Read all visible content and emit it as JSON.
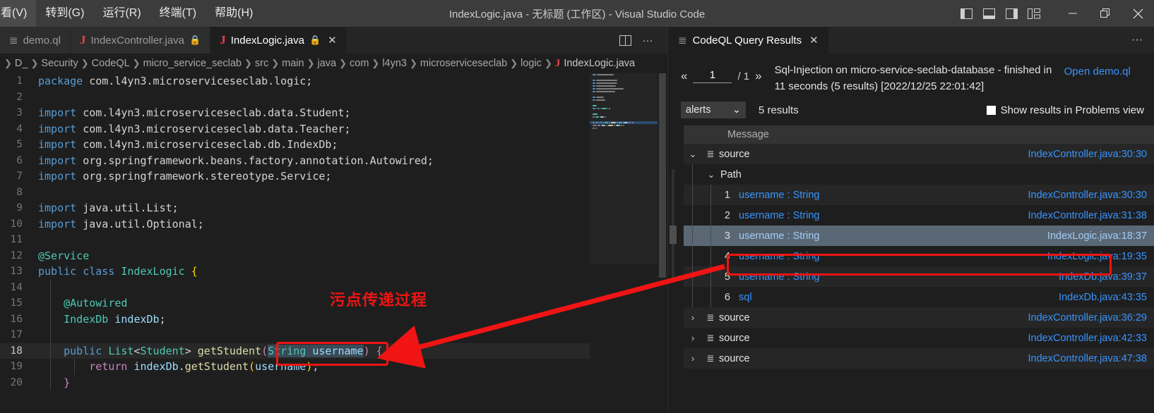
{
  "window": {
    "title": "IndexLogic.java - 无标题 (工作区) - Visual Studio Code",
    "menu": [
      "看(V)",
      "转到(G)",
      "运行(R)",
      "终端(T)",
      "帮助(H)"
    ],
    "layout_buttons": [
      {
        "name": "toggle-primary-sidebar",
        "label": "▉"
      },
      {
        "name": "toggle-panel",
        "label": "▤"
      },
      {
        "name": "toggle-secondary-sidebar",
        "label": "▥"
      },
      {
        "name": "customize-layout",
        "label": "▦"
      }
    ],
    "controls": {
      "minimize": "—",
      "restore": "❐",
      "close": "✕"
    }
  },
  "editor": {
    "tabs": [
      {
        "icon": "ql-icon",
        "label": "demo.ql",
        "active": false,
        "locked": false,
        "closable": false
      },
      {
        "icon": "java-icon",
        "label": "IndexController.java",
        "active": false,
        "locked": true,
        "closable": false
      },
      {
        "icon": "java-icon",
        "label": "IndexLogic.java",
        "active": true,
        "locked": true,
        "closable": true
      }
    ],
    "tab_actions": [
      {
        "name": "split-editor-icon",
        "label": "⫿⫿"
      },
      {
        "name": "more-actions-icon",
        "label": "···"
      }
    ],
    "breadcrumb": [
      "D_",
      "Security",
      "CodeQL",
      "micro_service_seclab",
      "src",
      "main",
      "java",
      "com",
      "l4yn3",
      "microserviceseclab",
      "logic",
      "IndexLogic.java"
    ],
    "current_line": 18,
    "lines": [
      {
        "n": 1,
        "tokens": [
          {
            "t": "package",
            "c": "kw"
          },
          {
            "t": " com.l4yn3.microserviceseclab.logic;",
            "c": "punc"
          }
        ]
      },
      {
        "n": 2,
        "tokens": []
      },
      {
        "n": 3,
        "tokens": [
          {
            "t": "import",
            "c": "kw"
          },
          {
            "t": " com.l4yn3.microserviceseclab.data.Student;",
            "c": "punc"
          }
        ]
      },
      {
        "n": 4,
        "tokens": [
          {
            "t": "import",
            "c": "kw"
          },
          {
            "t": " com.l4yn3.microserviceseclab.data.Teacher;",
            "c": "punc"
          }
        ]
      },
      {
        "n": 5,
        "tokens": [
          {
            "t": "import",
            "c": "kw"
          },
          {
            "t": " com.l4yn3.microserviceseclab.db.IndexDb;",
            "c": "punc"
          }
        ]
      },
      {
        "n": 6,
        "tokens": [
          {
            "t": "import",
            "c": "kw"
          },
          {
            "t": " org.springframework.beans.factory.annotation.Autowired;",
            "c": "punc"
          }
        ]
      },
      {
        "n": 7,
        "tokens": [
          {
            "t": "import",
            "c": "kw"
          },
          {
            "t": " org.springframework.stereotype.Service;",
            "c": "punc"
          }
        ]
      },
      {
        "n": 8,
        "tokens": []
      },
      {
        "n": 9,
        "tokens": [
          {
            "t": "import",
            "c": "kw"
          },
          {
            "t": " java.util.List;",
            "c": "punc"
          }
        ]
      },
      {
        "n": 10,
        "tokens": [
          {
            "t": "import",
            "c": "kw"
          },
          {
            "t": " java.util.Optional;",
            "c": "punc"
          }
        ]
      },
      {
        "n": 11,
        "tokens": []
      },
      {
        "n": 12,
        "tokens": [
          {
            "t": "@Service",
            "c": "ann"
          }
        ]
      },
      {
        "n": 13,
        "tokens": [
          {
            "t": "public",
            "c": "kw"
          },
          {
            "t": " ",
            "c": "punc"
          },
          {
            "t": "class",
            "c": "kw"
          },
          {
            "t": " ",
            "c": "punc"
          },
          {
            "t": "IndexLogic",
            "c": "typ"
          },
          {
            "t": " ",
            "c": "punc"
          },
          {
            "t": "{",
            "c": "br1"
          }
        ]
      },
      {
        "n": 14,
        "tokens": []
      },
      {
        "n": 15,
        "tokens": [
          {
            "t": "    @Autowired",
            "c": "ann"
          }
        ]
      },
      {
        "n": 16,
        "tokens": [
          {
            "t": "    ",
            "c": "punc"
          },
          {
            "t": "IndexDb",
            "c": "typ"
          },
          {
            "t": " ",
            "c": "punc"
          },
          {
            "t": "indexDb",
            "c": "var"
          },
          {
            "t": ";",
            "c": "punc"
          }
        ]
      },
      {
        "n": 17,
        "tokens": []
      },
      {
        "n": 18,
        "tokens": [
          {
            "t": "    ",
            "c": "punc"
          },
          {
            "t": "public",
            "c": "kw"
          },
          {
            "t": " ",
            "c": "punc"
          },
          {
            "t": "List",
            "c": "typ"
          },
          {
            "t": "<",
            "c": "punc"
          },
          {
            "t": "Student",
            "c": "typ"
          },
          {
            "t": "> ",
            "c": "punc"
          },
          {
            "t": "getStudent",
            "c": "fn"
          },
          {
            "t": "(",
            "c": "kw2"
          },
          {
            "t": "String",
            "c": "typ sel"
          },
          {
            "t": " ",
            "c": "sel"
          },
          {
            "t": "username",
            "c": "var sel"
          },
          {
            "t": ")",
            "c": "kw2"
          },
          {
            "t": " ",
            "c": "punc"
          },
          {
            "t": "{",
            "c": "kw2"
          }
        ]
      },
      {
        "n": 19,
        "tokens": [
          {
            "t": "        ",
            "c": "punc"
          },
          {
            "t": "return",
            "c": "kw2"
          },
          {
            "t": " ",
            "c": "punc"
          },
          {
            "t": "indexDb",
            "c": "var"
          },
          {
            "t": ".",
            "c": "punc"
          },
          {
            "t": "getStudent",
            "c": "fn"
          },
          {
            "t": "(",
            "c": "br1"
          },
          {
            "t": "username",
            "c": "var"
          },
          {
            "t": ")",
            "c": "br1"
          },
          {
            "t": ";",
            "c": "punc"
          }
        ]
      },
      {
        "n": 20,
        "tokens": [
          {
            "t": "    ",
            "c": "punc"
          },
          {
            "t": "}",
            "c": "kw2"
          }
        ]
      }
    ]
  },
  "results_panel": {
    "tab": {
      "label": "CodeQL Query Results",
      "icon": "list-icon",
      "close": "✕"
    },
    "more_actions": "···",
    "pager": {
      "prev": "«",
      "next": "»",
      "current_page": "1",
      "total": "/ 1"
    },
    "query_description": "Sql-Injection on micro-service-seclab-database - finished in 11 seconds (5 results) [2022/12/25 22:01:42]",
    "open_link": "Open demo.ql",
    "filter_select": {
      "value": "alerts",
      "chevron": "⌄"
    },
    "results_count": "5 results",
    "problems_checkbox": {
      "label": "Show results in Problems view",
      "checked": false
    },
    "column_header": "Message",
    "rows": [
      {
        "level": 0,
        "twisty": "⌄",
        "icon": "list-icon",
        "message": "source",
        "location": "IndexController.java:30:30",
        "style": "alt",
        "selected": false,
        "index": null
      },
      {
        "level": 1,
        "twisty": "⌄",
        "icon": "",
        "message": "Path",
        "location": "",
        "style": "normal",
        "selected": false,
        "index": null
      },
      {
        "level": 2,
        "twisty": "",
        "icon": "",
        "message": "username : String",
        "location": "IndexController.java:30:30",
        "style": "alt",
        "selected": false,
        "index": "1"
      },
      {
        "level": 2,
        "twisty": "",
        "icon": "",
        "message": "username : String",
        "location": "IndexController.java:31:38",
        "style": "normal",
        "selected": false,
        "index": "2"
      },
      {
        "level": 2,
        "twisty": "",
        "icon": "",
        "message": "username : String",
        "location": "IndexLogic.java:18:37",
        "style": "alt",
        "selected": true,
        "index": "3"
      },
      {
        "level": 2,
        "twisty": "",
        "icon": "",
        "message": "username : String",
        "location": "IndexLogic.java:19:35",
        "style": "normal",
        "selected": false,
        "index": "4"
      },
      {
        "level": 2,
        "twisty": "",
        "icon": "",
        "message": "username : String",
        "location": "IndexDb.java:39:37",
        "style": "alt",
        "selected": false,
        "index": "5"
      },
      {
        "level": 2,
        "twisty": "",
        "icon": "",
        "message": "sql",
        "location": "IndexDb.java:43:35",
        "style": "normal",
        "selected": false,
        "index": "6"
      },
      {
        "level": 0,
        "twisty": "›",
        "icon": "list-icon",
        "message": "source",
        "location": "IndexController.java:36:29",
        "style": "alt",
        "selected": false,
        "index": null
      },
      {
        "level": 0,
        "twisty": "›",
        "icon": "list-icon",
        "message": "source",
        "location": "IndexController.java:42:33",
        "style": "normal",
        "selected": false,
        "index": null
      },
      {
        "level": 0,
        "twisty": "›",
        "icon": "list-icon",
        "message": "source",
        "location": "IndexController.java:47:38",
        "style": "alt",
        "selected": false,
        "index": null
      }
    ]
  },
  "annotations": {
    "note_text": "污点传递过程",
    "accent_color": "#f01414"
  }
}
